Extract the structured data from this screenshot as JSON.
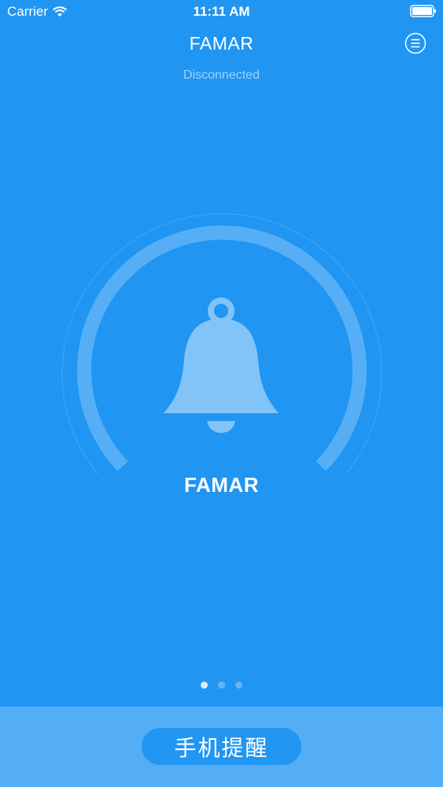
{
  "status_bar": {
    "carrier": "Carrier",
    "time": "11:11 AM",
    "wifi_icon": "wifi-icon",
    "battery_icon": "battery-icon"
  },
  "nav": {
    "title": "FAMAR",
    "menu_icon": "menu-icon"
  },
  "connection_status": "Disconnected",
  "device": {
    "name": "FAMAR",
    "icon": "bell-icon"
  },
  "pager": {
    "count": 3,
    "active_index": 0
  },
  "bottom": {
    "remind_button_label": "手机提醒"
  },
  "colors": {
    "background": "#2095f2",
    "bottom_bar": "#53aef6",
    "button": "#2196f2",
    "subtitle": "#9fd1fb"
  }
}
